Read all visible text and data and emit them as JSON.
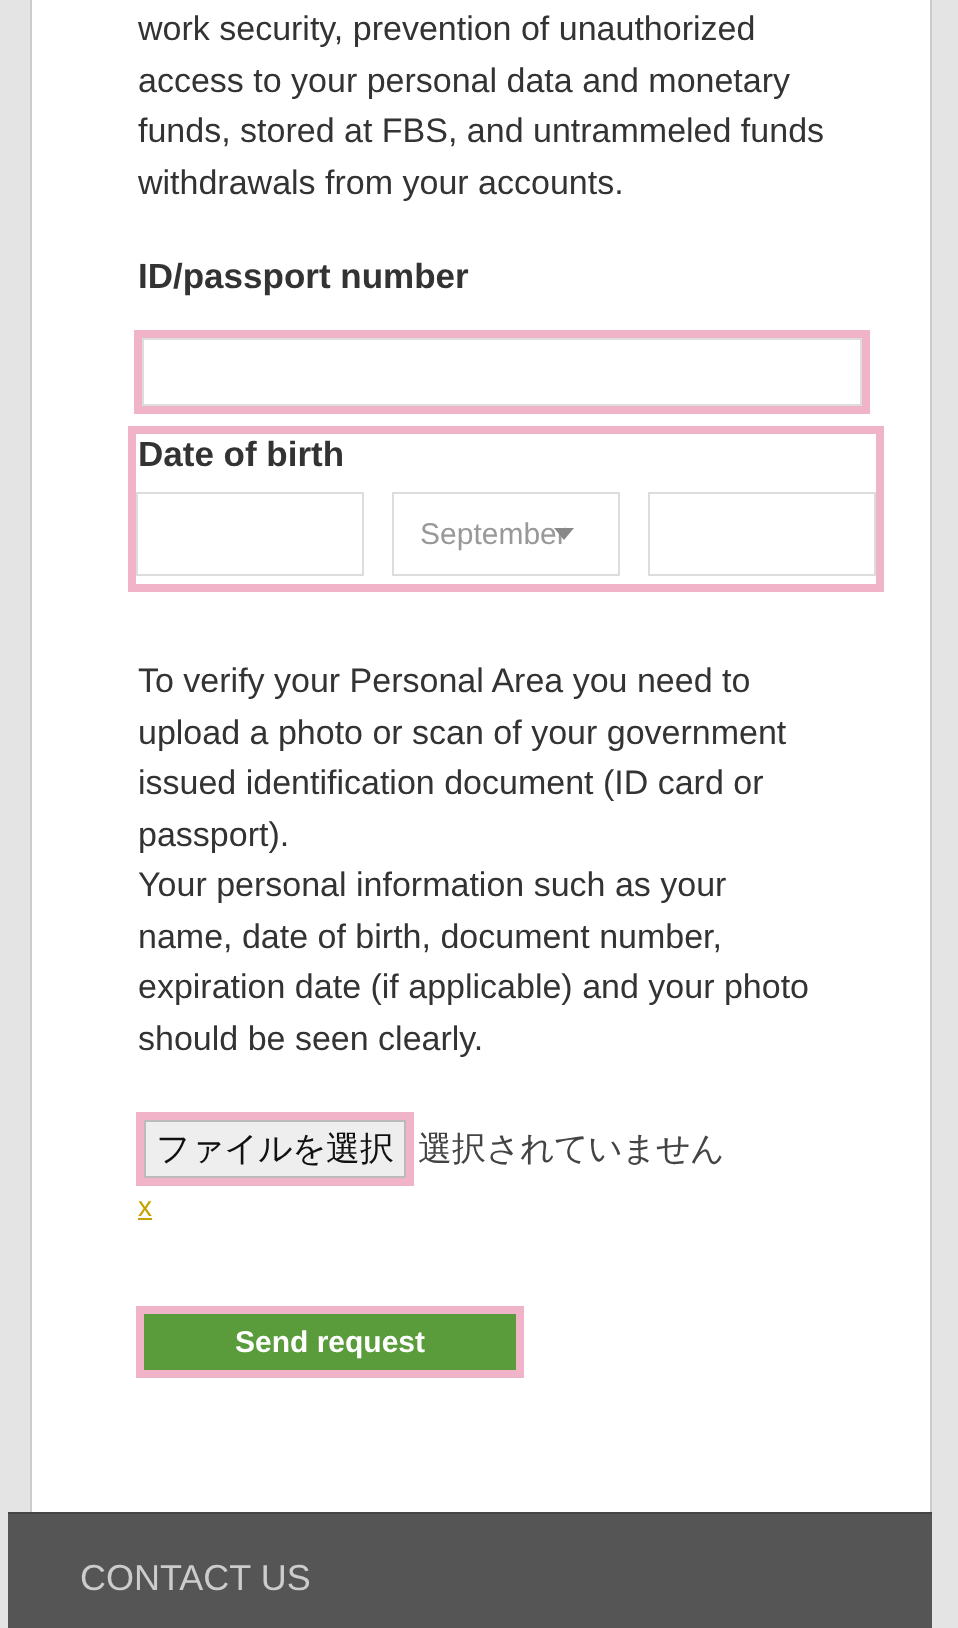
{
  "intro_text": "work security, prevention of unauthorized access to your personal data and monetary funds, stored at FBS, and untrammeled funds withdrawals from your accounts.",
  "id_field": {
    "label": "ID/passport number",
    "highlighted": true
  },
  "birth_date": {
    "label": "Date of birth",
    "highlighted": true,
    "month": "September"
  },
  "instructions": [
    "To verify your Personal Area you need to upload a photo or scan of your government issued identification document (ID card or passport).",
    "Your personal information such as your name, date of birth, document number, expiration date (if applicable) and your photo should be seen clearly."
  ],
  "file_picker": {
    "button": "ファイルを選択",
    "status": "選択されていません",
    "highlighted": true
  },
  "remove_link": "x",
  "submit": {
    "label": "Send request",
    "highlighted": true
  },
  "footer": {
    "title": "CONTACT US"
  }
}
